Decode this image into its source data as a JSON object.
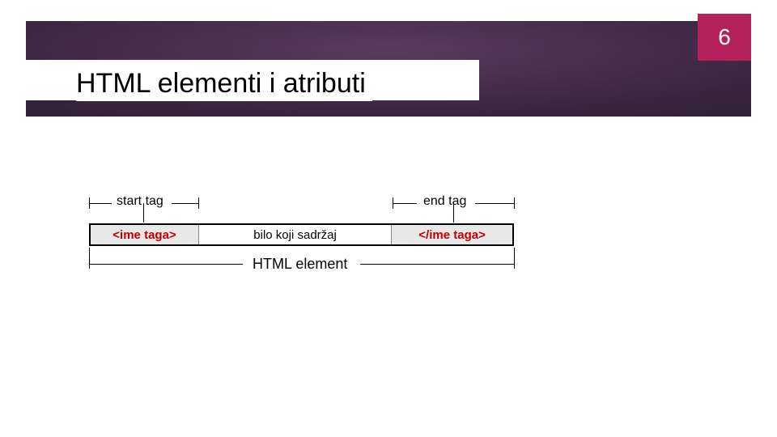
{
  "page_number": "6",
  "title": "HTML elementi i atributi",
  "diagram": {
    "start_tag_label": "start tag",
    "end_tag_label": "end tag",
    "element_label": "HTML element",
    "cells": {
      "start": "<ime taga>",
      "content": "bilo koji sadržaj",
      "end": "</ime taga>"
    }
  }
}
